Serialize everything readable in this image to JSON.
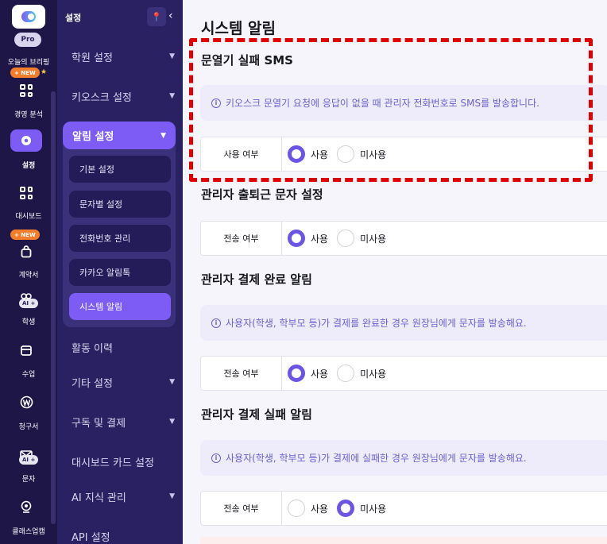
{
  "rail": {
    "pro": "Pro",
    "briefing": "오늘의 브리핑",
    "new1": "+ NEW",
    "new2": "+ NEW",
    "star": "★",
    "items": [
      "경영 분석",
      "설정",
      "대시보드",
      "계약서",
      "학생",
      "수업",
      "청구서",
      "문자",
      "클래스업캠"
    ],
    "ai1": "AI +",
    "ai2": "AI +"
  },
  "menu": {
    "header": "설정",
    "collapse": "‹",
    "items": {
      "member": "학원 설정",
      "kiosk": "키오스크 설정",
      "notify": "알림 설정",
      "activity": "활동 이력",
      "etc": "기타 설정",
      "subscribe": "구독 및 결제",
      "dashcard": "대시보드 카드 설정",
      "ai": "AI 지식 관리",
      "api": "API 설정"
    },
    "sub": [
      "기본 설정",
      "문자별 설정",
      "전화번호 관리",
      "카카오 알림톡",
      "시스템 알림"
    ]
  },
  "main": {
    "title": "시스템 알림",
    "sections": [
      {
        "title": "문열기 실패 SMS",
        "info": "키오스크 문열기 요청에 응답이 없을 때 관리자 전화번호로 SMS를 발송합니다.",
        "label": "사용 여부",
        "opt_on": "사용",
        "opt_off": "미사용",
        "selected": "사용"
      },
      {
        "title": "관리자 출퇴근 문자 설정",
        "label": "전송 여부",
        "opt_on": "사용",
        "opt_off": "미사용",
        "selected": "사용"
      },
      {
        "title": "관리자 결제 완료 알림",
        "info": "사용자(학생, 학부모 등)가 결제를 완료한 경우 원장님에게 문자를 발송해요.",
        "label": "전송 여부",
        "opt_on": "사용",
        "opt_off": "미사용",
        "selected": "사용"
      },
      {
        "title": "관리자 결제 실패 알림",
        "info": "사용자(학생, 학부모 등)가 결제에 실패한 경우 원장님에게 문자를 발송해요.",
        "label": "전송 여부",
        "opt_on": "사용",
        "opt_off": "미사용",
        "selected": "미사용"
      }
    ]
  },
  "colors": {
    "accent": "#7c5cf5",
    "rail": "#1f1648",
    "menu": "#2a2163",
    "highlight": "#e00000"
  }
}
